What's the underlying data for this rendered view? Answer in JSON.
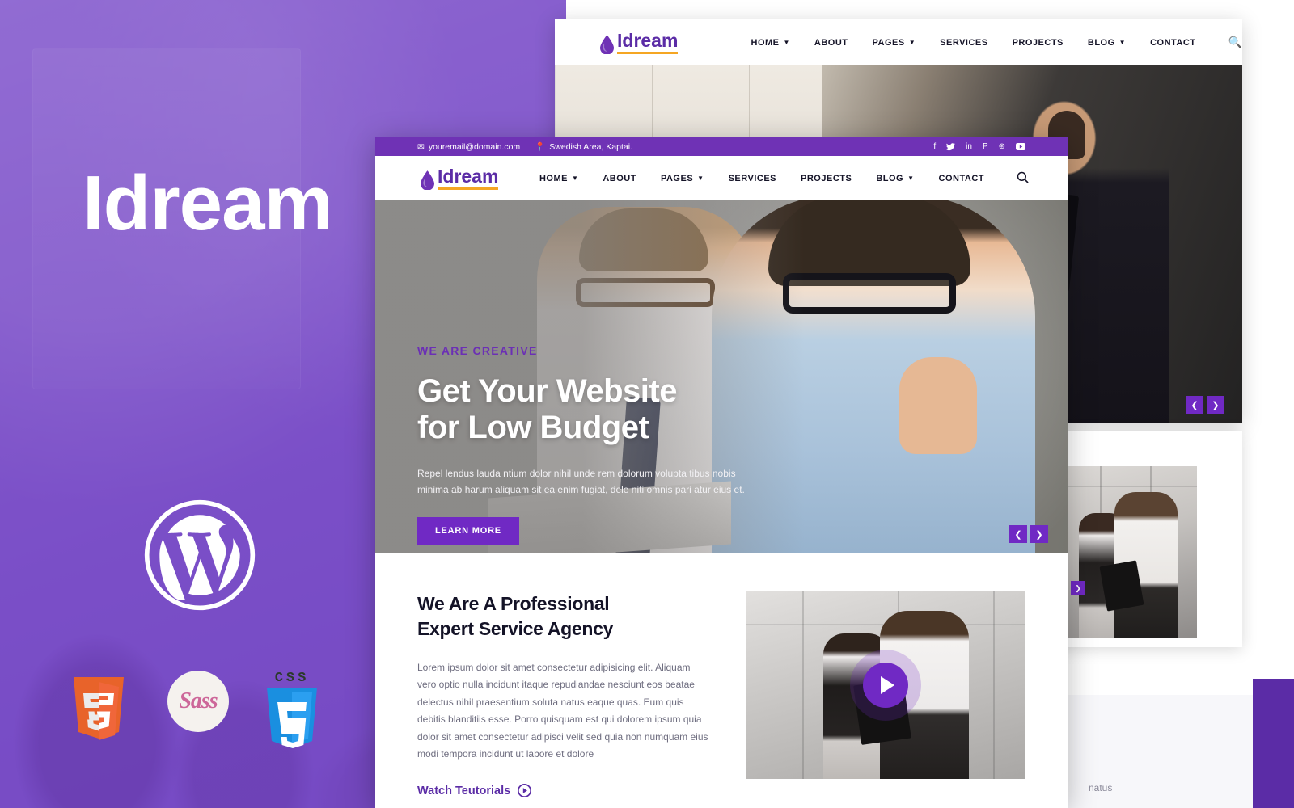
{
  "promo": {
    "title": "Idream",
    "wordpress_icon": "wordpress-logo",
    "tech": [
      {
        "name": "html5-logo",
        "label": "5"
      },
      {
        "name": "sass-logo",
        "label": "Sass"
      },
      {
        "name": "css3-logo",
        "label": "CSS",
        "mark": "3"
      }
    ],
    "brand_color": "#7a52c4"
  },
  "theme": {
    "purple": "#7029c4",
    "deep_purple": "#5b2ca6",
    "topbar_purple": "#6f32b5",
    "accent_underline": "#f5a623",
    "dark_text": "#141327",
    "muted_text": "#6f6e80"
  },
  "topbar": {
    "email": "youremail@domain.com",
    "email_icon": "envelope-icon",
    "location": "Swedish Area, Kaptai.",
    "location_icon": "map-pin-icon",
    "social": [
      {
        "name": "facebook-icon",
        "glyph": "f"
      },
      {
        "name": "twitter-icon",
        "glyph": "ᵛ"
      },
      {
        "name": "linkedin-icon",
        "glyph": "in"
      },
      {
        "name": "pinterest-icon",
        "glyph": "P"
      },
      {
        "name": "dribbble-icon",
        "glyph": "⊛"
      },
      {
        "name": "youtube-icon",
        "glyph": "▶"
      }
    ]
  },
  "brand": {
    "logo_icon": "water-drop-icon",
    "name": "Idream"
  },
  "nav": {
    "items": [
      {
        "label": "HOME",
        "has_dropdown": true
      },
      {
        "label": "ABOUT",
        "has_dropdown": false
      },
      {
        "label": "PAGES",
        "has_dropdown": true
      },
      {
        "label": "SERVICES",
        "has_dropdown": false
      },
      {
        "label": "PROJECTS",
        "has_dropdown": false
      },
      {
        "label": "BLOG",
        "has_dropdown": true
      },
      {
        "label": "CONTACT",
        "has_dropdown": false
      }
    ],
    "search_icon": "search-icon",
    "caret_icon": "chevron-down-icon"
  },
  "hero": {
    "eyebrow": "WE ARE CREATIVE",
    "title_line1": "Get Your Website",
    "title_line2": "for Low Budget",
    "description": "Repel lendus lauda ntium dolor nihil unde rem dolorum volupta tibus nobis minima ab harum aliquam sit ea enim fugiat, dele niti omnis pari atur eius et.",
    "button_label": "LEARN MORE",
    "prev_icon": "chevron-left-icon",
    "next_icon": "chevron-right-icon"
  },
  "about": {
    "title_line1": "We Are A Professional",
    "title_line2": "Expert Service Agency",
    "text": "Lorem ipsum dolor sit amet consectetur adipisicing elit. Aliquam vero optio nulla incidunt itaque repudiandae nesciunt eos beatae delectus nihil praesentium soluta natus eaque quas. Eum quis debitis blanditiis esse. Porro quisquam est qui dolorem ipsum quia dolor sit amet consectetur adipisci velit sed quia non numquam eius modi tempora incidunt ut labore et dolore",
    "link_label": "Watch Teutorials",
    "link_icon": "play-circle-icon",
    "video_play_icon": "play-icon"
  },
  "ghost": {
    "partial_text": "natus"
  }
}
